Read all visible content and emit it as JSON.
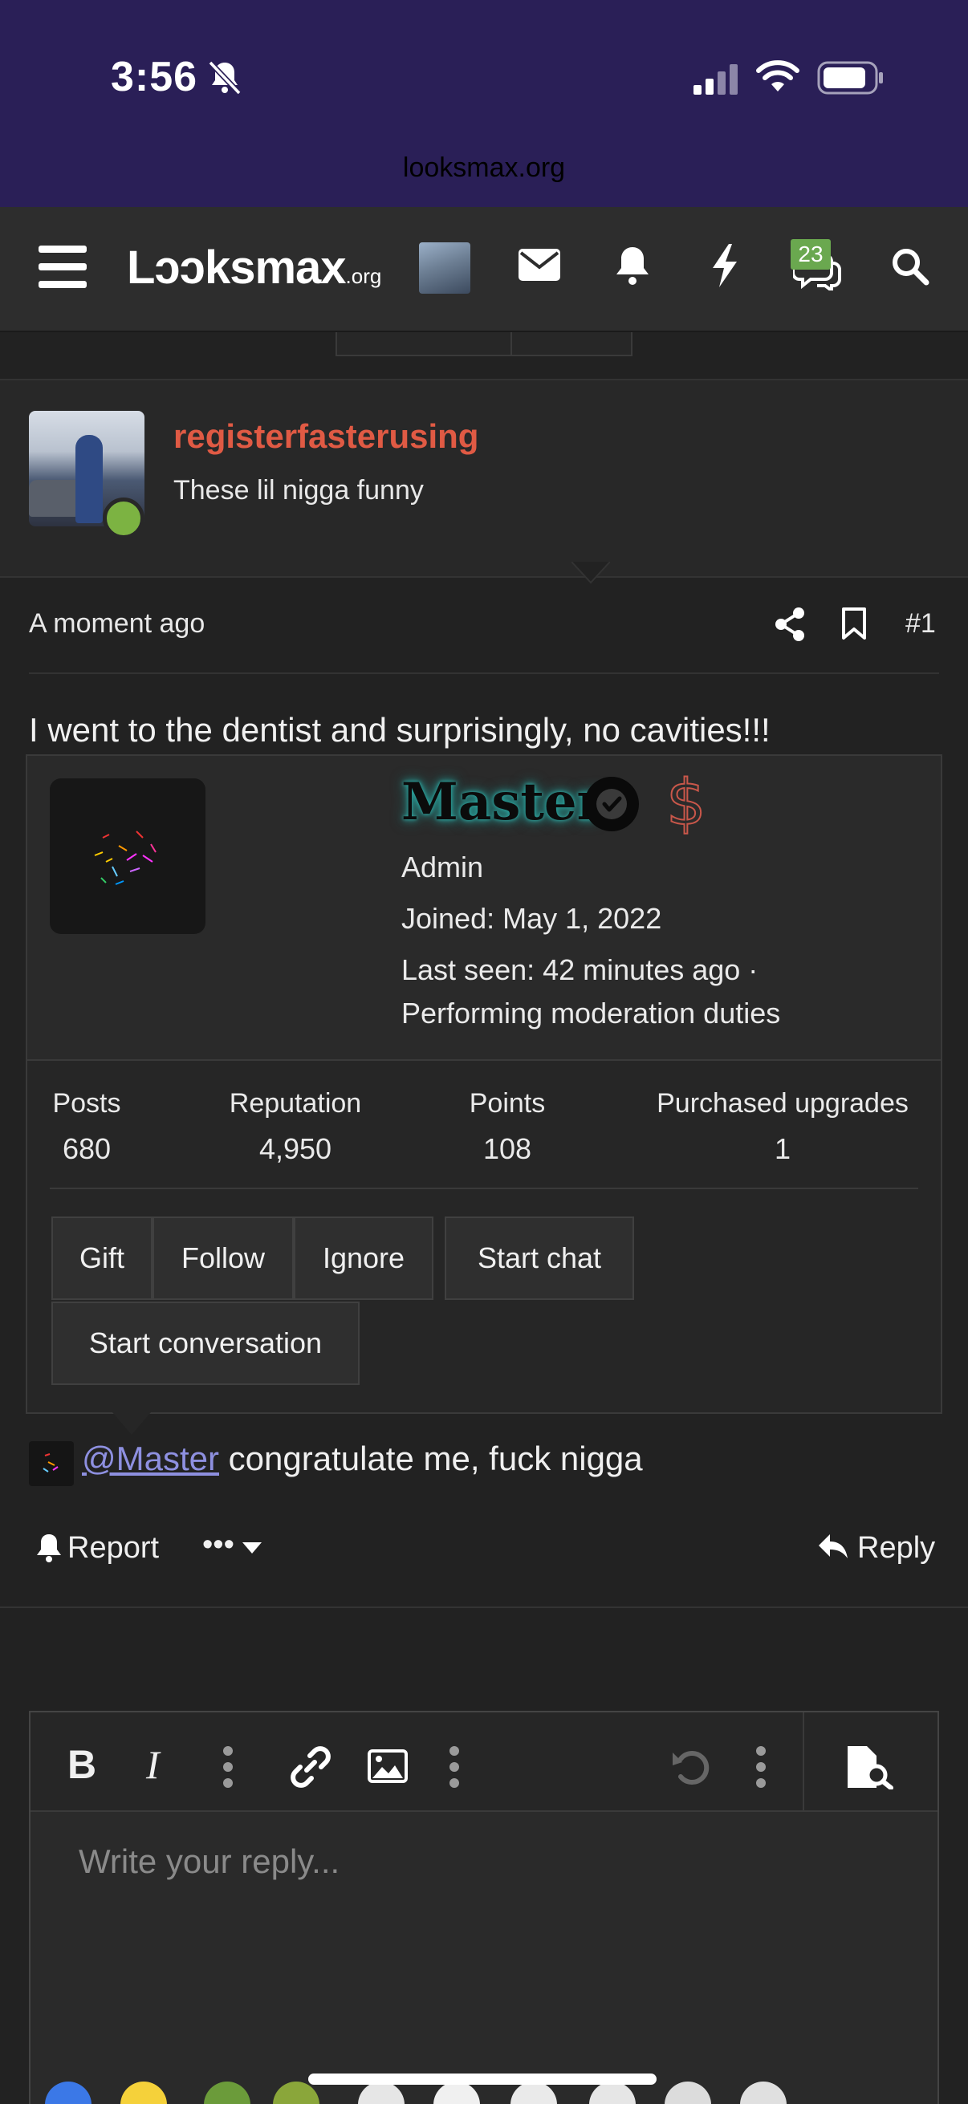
{
  "status_bar": {
    "time": "3:56",
    "url": "looksmax.org"
  },
  "nav": {
    "logo_main": "Lɔɔksmax",
    "logo_suffix": ".org",
    "conversations_badge": "23",
    "icons": [
      "menu-icon",
      "envelope-icon",
      "bell-icon",
      "lightning-icon",
      "chat-icon",
      "search-icon"
    ]
  },
  "post": {
    "author": "registerfasterusing",
    "author_title": "These lil nigga funny",
    "time": "A moment ago",
    "number": "#1",
    "body_line1": "I went to the dentist and surprisingly, no cavities!!!",
    "mention": "@Master",
    "body_line2_rest": " congratulate me, fuck nigga"
  },
  "member_card": {
    "name": "Master",
    "dollar": "$",
    "role": "Admin",
    "joined": "Joined: May 1, 2022",
    "last_seen_1": "Last seen: 42 minutes ago ·",
    "last_seen_2": "Performing moderation duties",
    "stats": [
      {
        "label": "Posts",
        "value": "680"
      },
      {
        "label": "Reputation",
        "value": "4,950"
      },
      {
        "label": "Points",
        "value": "108"
      },
      {
        "label": "Purchased upgrades",
        "value": "1"
      }
    ],
    "buttons": {
      "gift": "Gift",
      "follow": "Follow",
      "ignore": "Ignore",
      "start_chat": "Start chat",
      "start_conversation": "Start conversation"
    }
  },
  "actions": {
    "report": "Report",
    "more": "•••",
    "reply": "Reply"
  },
  "editor": {
    "placeholder": "Write your reply..."
  },
  "colors": {
    "status_bar_bg": "#2a1f57",
    "username": "#e05a44",
    "online": "#7cb342",
    "badge": "#6aa84f",
    "mention": "#8e90e0"
  }
}
